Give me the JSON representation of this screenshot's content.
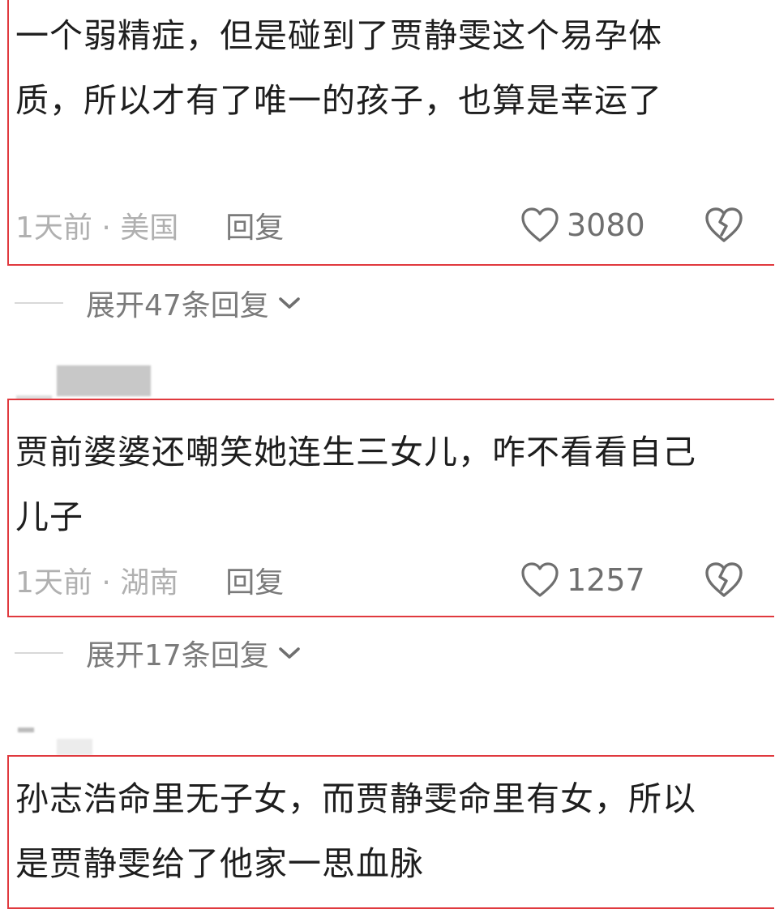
{
  "comments": [
    {
      "text": "一个弱精症，但是碰到了贾静雯这个易孕体质，所以才有了唯一的孩子，也算是幸运了",
      "time_location": "1天前 · 美国",
      "reply_label": "回复",
      "likes": "3080"
    },
    {
      "text": "贾前婆婆还嘲笑她连生三女儿，咋不看看自己儿子",
      "time_location": "1天前 · 湖南",
      "reply_label": "回复",
      "likes": "1257"
    },
    {
      "text": "孙志浩命里无子女，而贾静雯命里有女，所以是贾静雯给了他家一思血脉"
    }
  ],
  "expand_replies": [
    {
      "label": "展开47条回复"
    },
    {
      "label": "展开17条回复"
    }
  ],
  "icons": {
    "like": "heart-outline-icon",
    "dislike": "broken-heart-icon",
    "expand": "chevron-down-icon"
  },
  "colors": {
    "highlight_border": "#e0393e",
    "meta_text": "#b3b3b3",
    "action_text": "#7a7a7a"
  }
}
